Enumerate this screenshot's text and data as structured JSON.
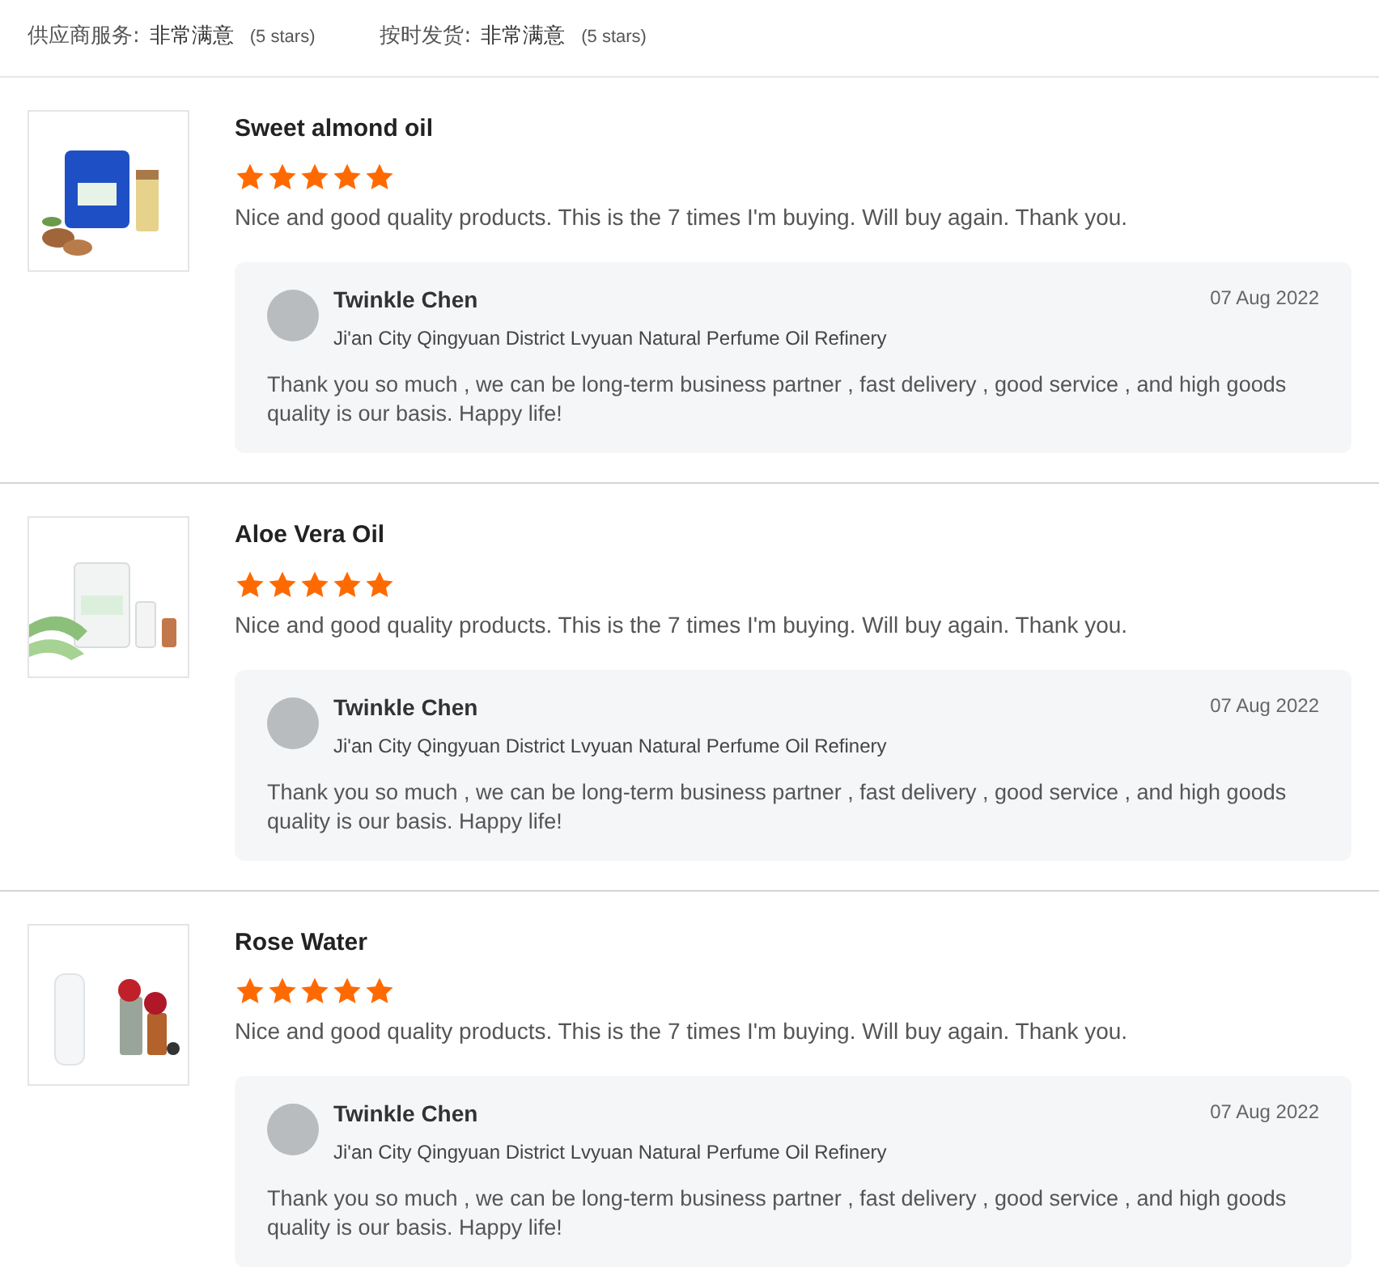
{
  "ratings": [
    {
      "label": "供应商服务:",
      "value": "非常满意",
      "stars_text": "(5 stars)"
    },
    {
      "label": "按时发货:",
      "value": "非常满意",
      "stars_text": "(5 stars)"
    }
  ],
  "reviews": [
    {
      "product": "Sweet almond oil",
      "stars": 5,
      "comment": "Nice and good quality products. This is the 7 times I'm buying. Will buy again. Thank you.",
      "reply": {
        "name": "Twinkle Chen",
        "company": "Ji'an City Qingyuan District Lvyuan Natural Perfume Oil Refinery",
        "date": "07 Aug 2022",
        "text": "Thank you so much , we can be long-term business partner , fast delivery , good service , and high goods quality is our basis. Happy life!"
      }
    },
    {
      "product": "Aloe Vera Oil",
      "stars": 5,
      "comment": "Nice and good quality products. This is the 7 times I'm buying. Will buy again. Thank you.",
      "reply": {
        "name": "Twinkle Chen",
        "company": "Ji'an City Qingyuan District Lvyuan Natural Perfume Oil Refinery",
        "date": "07 Aug 2022",
        "text": "Thank you so much , we can be long-term business partner , fast delivery , good service , and high goods quality is our basis. Happy life!"
      }
    },
    {
      "product": "Rose Water",
      "stars": 5,
      "comment": "Nice and good quality products. This is the 7 times I'm buying. Will buy again. Thank you.",
      "reply": {
        "name": "Twinkle Chen",
        "company": "Ji'an City Qingyuan District Lvyuan Natural Perfume Oil Refinery",
        "date": "07 Aug 2022",
        "text": "Thank you so much , we can be long-term business partner , fast delivery , good service , and high goods quality is our basis. Happy life!"
      }
    }
  ]
}
